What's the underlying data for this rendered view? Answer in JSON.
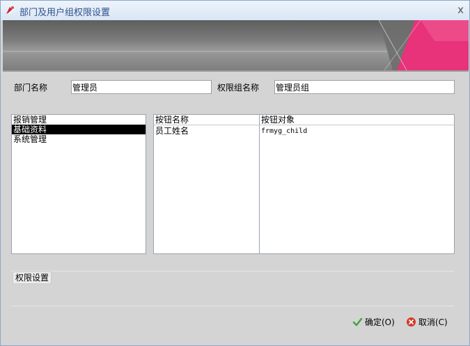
{
  "window": {
    "title": "部门及用户组权限设置",
    "close_glyph": "x"
  },
  "form": {
    "dept_label": "部门名称",
    "dept_value": "管理员",
    "group_label": "权限组名称",
    "group_value": "管理员组"
  },
  "module_list": {
    "items": [
      "报销管理",
      "基础资料",
      "系统管理"
    ],
    "selected_index": 1
  },
  "button_grid": {
    "columns": [
      "按钮名称",
      "按钮对象"
    ],
    "rows": [
      [
        "员工姓名",
        "frmyg_child"
      ]
    ]
  },
  "permissions": {
    "group_label": "权限设置"
  },
  "footer": {
    "ok_label": "确定(O)",
    "cancel_label": "取消(C)"
  },
  "colors": {
    "title_text": "#2f4f8a",
    "banner_accent": "#e8327a",
    "ok_icon": "#3da53b",
    "cancel_icon": "#d23a2a"
  },
  "icons": {
    "app": "app-logo-icon",
    "ok": "checkmark-icon",
    "cancel": "cancel-circle-icon"
  }
}
